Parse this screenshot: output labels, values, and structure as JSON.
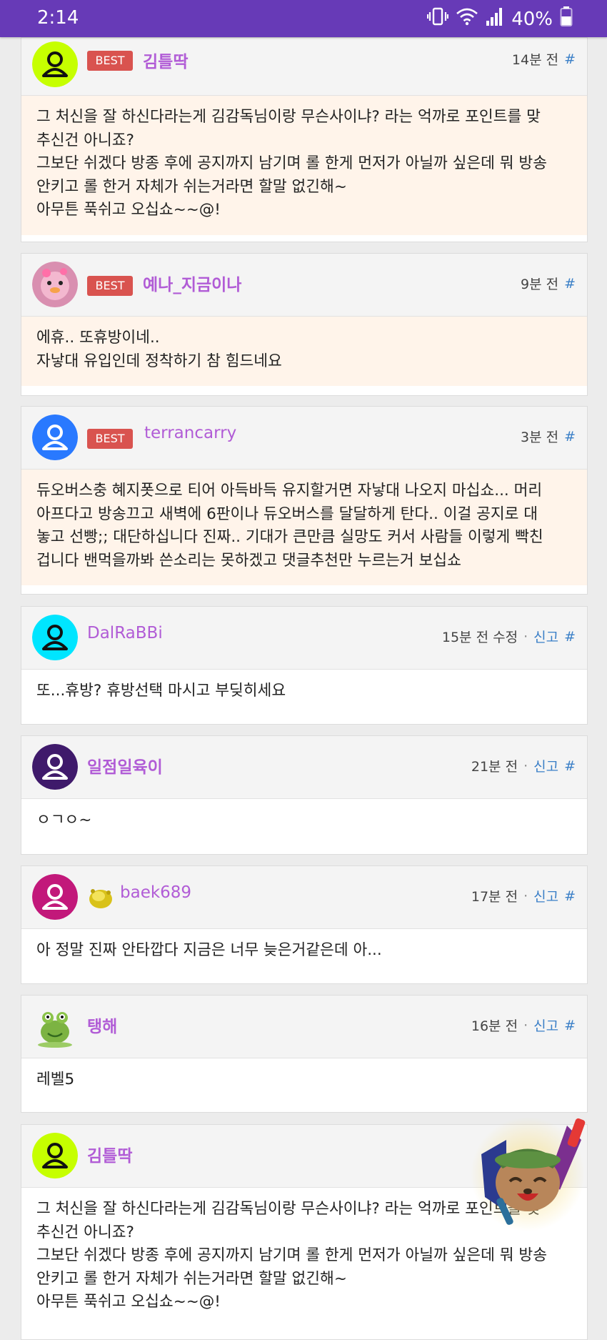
{
  "status_bar": {
    "time": "2:14",
    "battery": "40%"
  },
  "comments": [
    {
      "author": "김틀딱",
      "best": true,
      "best_label": "BEST",
      "time": "14분 전",
      "report": "",
      "hash": "#",
      "avatar_color": "#c6ff00",
      "text": "그 처신을 잘 하신다라는게 김감독님이랑 무슨사이냐? 라는 억까로 포인트를 맞\n추신건 아니죠?\n그보단 쉬겠다 방종 후에 공지까지 남기며 롤 한게 먼저가 아닐까 싶은데 뭐 방송\n안키고 롤 한거 자체가 쉬는거라면 할말 없긴해~\n아무튼 푹쉬고 오십쇼~~@!"
    },
    {
      "author": "예나_지금이나",
      "best": true,
      "best_label": "BEST",
      "time": "9분 전",
      "report": "",
      "hash": "#",
      "avatar_color": "#e8a0c0",
      "text": "에휴.. 또휴방이네..\n자낳대 유입인데 정착하기 참 힘드네요"
    },
    {
      "author": "terrancarry",
      "best": true,
      "best_label": "BEST",
      "time": "3분 전",
      "report": "",
      "hash": "#",
      "avatar_color": "#2979ff",
      "text": "듀오버스충 혜지폿으로 티어 아득바득 유지할거면 자낳대 나오지 마십쇼... 머리\n아프다고 방송끄고 새벽에 6판이나 듀오버스를 달달하게 탄다.. 이걸 공지로 대\n놓고 선빵;; 대단하십니다 진짜.. 기대가 큰만큼 실망도 커서 사람들 이렇게 빡친\n겁니다 밴먹을까봐 쓴소리는 못하겠고 댓글추천만 누르는거 보십쇼"
    },
    {
      "author": "DalRaBBi",
      "best": false,
      "time": "15분 전 수정",
      "report": "신고",
      "hash": "#",
      "avatar_color": "#00e5ff",
      "text": "또...휴방? 휴방선택 마시고 부딪히세요"
    },
    {
      "author": "일점일육이",
      "best": false,
      "time": "21분 전",
      "report": "신고",
      "hash": "#",
      "avatar_color": "#3f1a6b",
      "text": "ㅇㄱㅇ~"
    },
    {
      "author": "baek689",
      "best": false,
      "time": "17분 전",
      "report": "신고",
      "hash": "#",
      "avatar_color": "#c2187a",
      "text": "아 정말 진짜 안타깝다 지금은 너무 늦은거같은데 아..."
    },
    {
      "author": "탱해",
      "best": false,
      "time": "16분 전",
      "report": "신고",
      "hash": "#",
      "avatar_color": "#7cb342",
      "text": "레벨5"
    },
    {
      "author": "김틀딱",
      "best": false,
      "time": "",
      "report": "",
      "hash": "",
      "avatar_color": "#c6ff00",
      "text": "그 처신을 잘 하신다라는게 김감독님이랑 무슨사이냐? 라는 억까로 포인트를 맞\n추신건 아니죠?\n그보단 쉬겠다 방종 후에 공지까지 남기며 롤 한게 먼저가 아닐까 싶은데 뭐 방송\n안키고 롤 한거 자체가 쉬는거라면 할말 없긴해~\n아무튼 푹쉬고 오십쇼~~@!"
    }
  ]
}
